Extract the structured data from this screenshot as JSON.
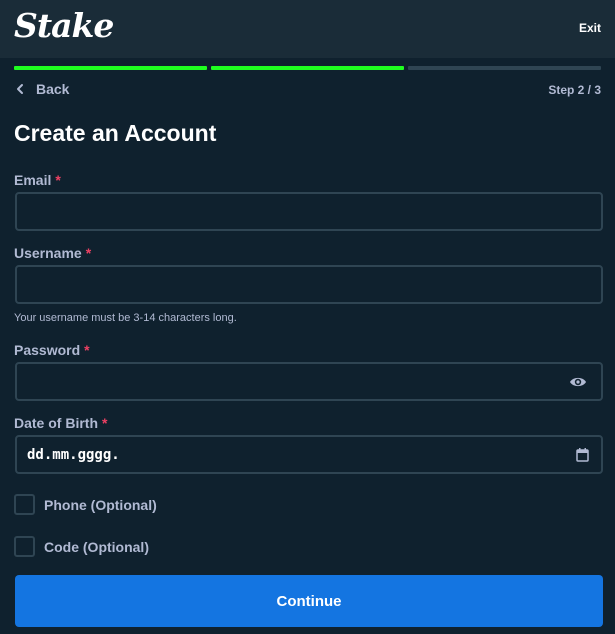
{
  "header": {
    "logo": "Stake",
    "exit_label": "Exit"
  },
  "progress": {
    "current_step": 2,
    "total_steps": 3
  },
  "nav": {
    "back_label": "Back",
    "step_text": "Step 2 / 3"
  },
  "form": {
    "title": "Create an Account",
    "email": {
      "label": "Email",
      "required_mark": "*",
      "value": ""
    },
    "username": {
      "label": "Username",
      "required_mark": "*",
      "value": "",
      "hint": "Your username must be 3-14 characters long."
    },
    "password": {
      "label": "Password",
      "required_mark": "*",
      "value": "",
      "toggle_icon": "eye-icon"
    },
    "dob": {
      "label": "Date of Birth",
      "required_mark": "*",
      "placeholder": "dd.mm.gggg.",
      "icon": "calendar-icon"
    },
    "phone_option": {
      "label": "Phone (Optional)",
      "checked": false
    },
    "code_option": {
      "label": "Code (Optional)",
      "checked": false
    },
    "continue_label": "Continue"
  },
  "colors": {
    "background": "#0f212e",
    "header": "#1a2c38",
    "progress_done": "#1fff20",
    "progress_pending": "#2f4553",
    "accent_button": "#1475e1",
    "required": "#ed4163",
    "label": "#b1bad3"
  }
}
